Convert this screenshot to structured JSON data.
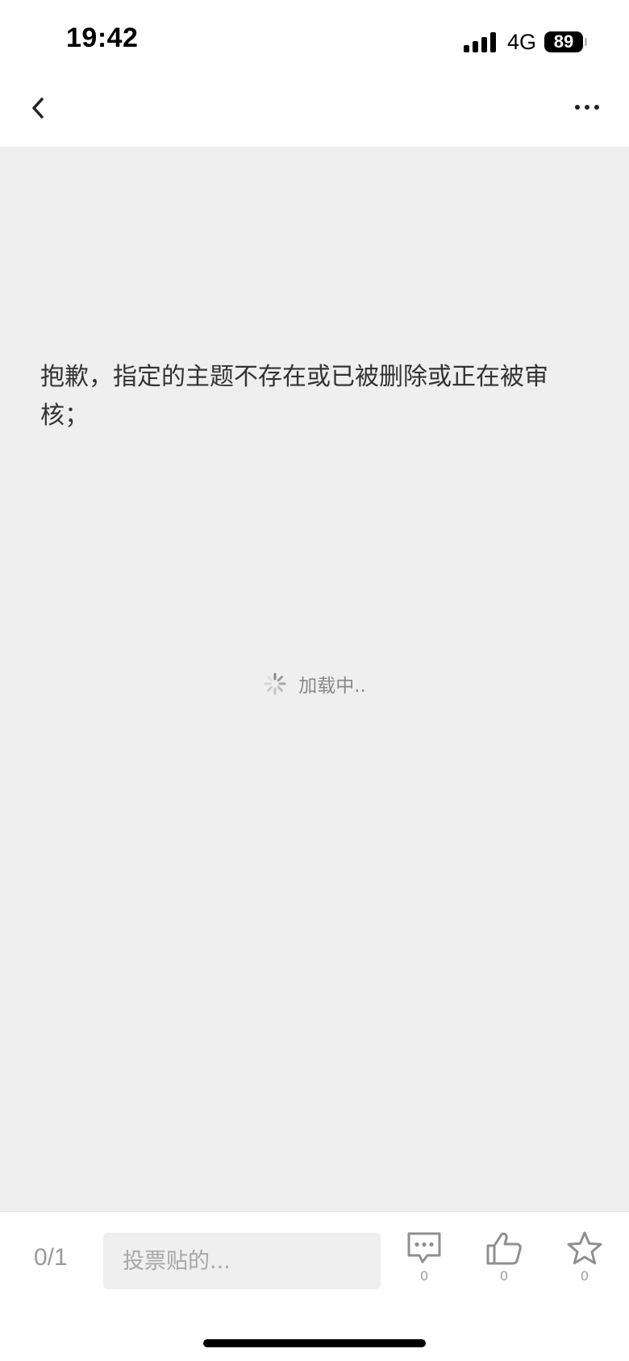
{
  "status_bar": {
    "time": "19:42",
    "network": "4G",
    "battery": "89",
    "signal_icon": "signal-bars-icon",
    "battery_icon": "battery-icon"
  },
  "nav": {
    "back_icon": "chevron-left-icon",
    "more_icon": "more-dots-icon"
  },
  "content": {
    "error_message": "抱歉，指定的主题不存在或已被删除或正在被审核；",
    "loading_text": "加载中..",
    "loading_icon": "spinner-icon"
  },
  "toolbar": {
    "page_counter": "0/1",
    "input_placeholder": "投票贴的...",
    "input_value": "",
    "comments": {
      "icon": "comment-bubble-icon",
      "count": "0"
    },
    "likes": {
      "icon": "thumbs-up-icon",
      "count": "0"
    },
    "favorites": {
      "icon": "star-icon",
      "count": "0"
    }
  },
  "colors": {
    "content_background": "#efefef",
    "muted_text": "#9a9a9a",
    "body_text": "#333333"
  }
}
